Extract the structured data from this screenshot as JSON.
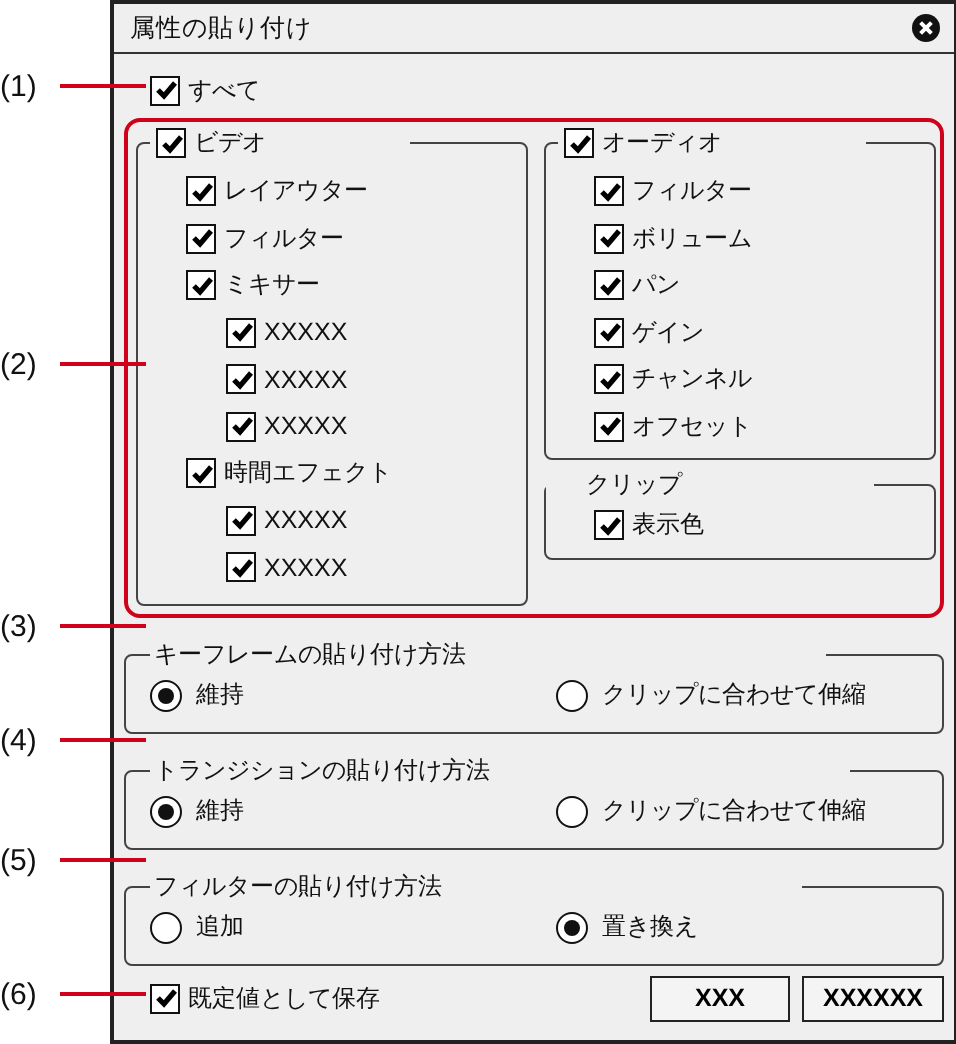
{
  "window": {
    "title": "属性の貼り付け"
  },
  "all": {
    "label": "すべて",
    "checked": true
  },
  "video": {
    "label": "ビデオ",
    "checked": true,
    "items": [
      {
        "label": "レイアウター",
        "checked": true
      },
      {
        "label": "フィルター",
        "checked": true
      },
      {
        "label": "ミキサー",
        "checked": true,
        "children": [
          {
            "label": "XXXXX",
            "checked": true
          },
          {
            "label": "XXXXX",
            "checked": true
          },
          {
            "label": "XXXXX",
            "checked": true
          }
        ]
      },
      {
        "label": "時間エフェクト",
        "checked": true,
        "children": [
          {
            "label": "XXXXX",
            "checked": true
          },
          {
            "label": "XXXXX",
            "checked": true
          }
        ]
      }
    ]
  },
  "audio": {
    "label": "オーディオ",
    "checked": true,
    "items": [
      {
        "label": "フィルター",
        "checked": true
      },
      {
        "label": "ボリューム",
        "checked": true
      },
      {
        "label": "パン",
        "checked": true
      },
      {
        "label": "ゲイン",
        "checked": true
      },
      {
        "label": "チャンネル",
        "checked": true
      },
      {
        "label": "オフセット",
        "checked": true
      }
    ]
  },
  "clip": {
    "title": "クリップ",
    "items": [
      {
        "label": "表示色",
        "checked": true
      }
    ]
  },
  "paste_methods": [
    {
      "title": "キーフレームの貼り付け方法",
      "options": [
        {
          "label": "維持",
          "selected": true
        },
        {
          "label": "クリップに合わせて伸縮",
          "selected": false
        }
      ]
    },
    {
      "title": "トランジションの貼り付け方法",
      "options": [
        {
          "label": "維持",
          "selected": true
        },
        {
          "label": "クリップに合わせて伸縮",
          "selected": false
        }
      ]
    },
    {
      "title": "フィルターの貼り付け方法",
      "options": [
        {
          "label": "追加",
          "selected": false
        },
        {
          "label": "置き換え",
          "selected": true
        }
      ]
    }
  ],
  "save_default": {
    "label": "既定値として保存",
    "checked": true
  },
  "buttons": [
    "XXX",
    "XXXXXX"
  ],
  "callouts": [
    "(1)",
    "(2)",
    "(3)",
    "(4)",
    "(5)",
    "(6)"
  ]
}
